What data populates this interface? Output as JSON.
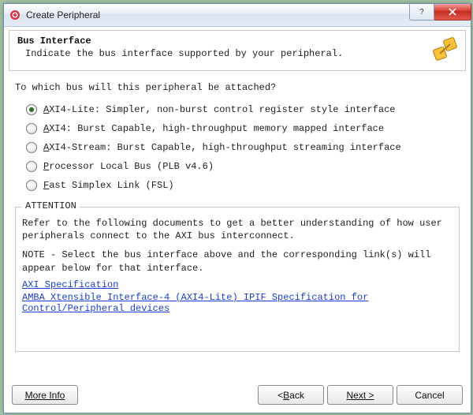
{
  "window": {
    "title": "Create Peripheral"
  },
  "header": {
    "heading": "Bus Interface",
    "subtext": "Indicate the bus interface supported by your peripheral."
  },
  "question": "To which bus will this peripheral be attached?",
  "options": [
    {
      "key": "A",
      "rest": "XI4-Lite: Simpler, non-burst control register style interface",
      "selected": true
    },
    {
      "key": "A",
      "rest": "XI4: Burst Capable, high-throughput memory mapped interface",
      "selected": false
    },
    {
      "key": "A",
      "rest": "XI4-Stream: Burst Capable, high-throughput streaming interface",
      "selected": false
    },
    {
      "key": "P",
      "rest": "rocessor Local Bus (PLB v4.6)",
      "selected": false
    },
    {
      "key": "F",
      "rest": "ast Simplex Link (FSL)",
      "selected": false
    }
  ],
  "attention": {
    "title": "ATTENTION",
    "para1": "Refer to the following documents to get a better understanding of how user peripherals connect to the AXI bus interconnect.",
    "para2": "NOTE - Select the bus interface above and the corresponding link(s) will appear below for that interface.",
    "links": [
      "AXI Specification",
      "AMBA Xtensible Interface-4 (AXI4-Lite) IPIF Specification for Control/Peripheral devices"
    ]
  },
  "buttons": {
    "moreinfo_key": "M",
    "moreinfo_rest": "ore Info",
    "back_lt": "< ",
    "back_key": "B",
    "back_rest": "ack",
    "next_key": "N",
    "next_rest": "ext >",
    "cancel": "Cancel"
  }
}
